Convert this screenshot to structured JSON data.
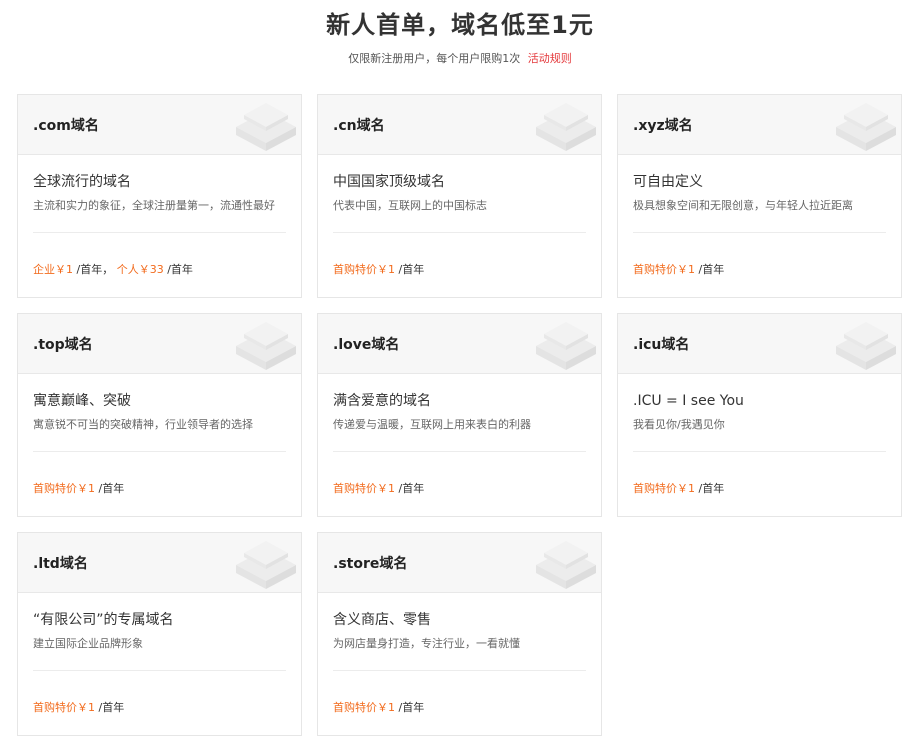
{
  "header": {
    "title": "新人首单，域名低至1元",
    "subtitle": "仅限新注册用户，每个用户限购1次",
    "rules_link": "活动规则"
  },
  "colors": {
    "accent_orange": "#f26b1d",
    "link_red": "#e4393c"
  },
  "cards": [
    {
      "name": ".com域名",
      "tagline": "全球流行的域名",
      "desc": "主流和实力的象征，全球注册量第一，流通性最好",
      "price_a": "企业￥1",
      "unit_a": "/首年，",
      "price_b": "个人￥33",
      "unit_b": "/首年"
    },
    {
      "name": ".cn域名",
      "tagline": "中国国家顶级域名",
      "desc": "代表中国，互联网上的中国标志",
      "price_a": "首购特价￥1",
      "unit_a": "/首年",
      "price_b": "",
      "unit_b": ""
    },
    {
      "name": ".xyz域名",
      "tagline": "可自由定义",
      "desc": "极具想象空间和无限创意，与年轻人拉近距离",
      "price_a": "首购特价￥1",
      "unit_a": "/首年",
      "price_b": "",
      "unit_b": ""
    },
    {
      "name": ".top域名",
      "tagline": "寓意巅峰、突破",
      "desc": "寓意锐不可当的突破精神，行业领导者的选择",
      "price_a": "首购特价￥1",
      "unit_a": "/首年",
      "price_b": "",
      "unit_b": ""
    },
    {
      "name": ".love域名",
      "tagline": "满含爱意的域名",
      "desc": "传递爱与温暖，互联网上用来表白的利器",
      "price_a": "首购特价￥1",
      "unit_a": "/首年",
      "price_b": "",
      "unit_b": ""
    },
    {
      "name": ".icu域名",
      "tagline": ".ICU = I see You",
      "desc": "我看见你/我遇见你",
      "price_a": "首购特价￥1",
      "unit_a": "/首年",
      "price_b": "",
      "unit_b": ""
    },
    {
      "name": ".ltd域名",
      "tagline": "“有限公司”的专属域名",
      "desc": "建立国际企业品牌形象",
      "price_a": "首购特价￥1",
      "unit_a": "/首年",
      "price_b": "",
      "unit_b": ""
    },
    {
      "name": ".store域名",
      "tagline": "含义商店、零售",
      "desc": "为网店量身打造，专注行业，一看就懂",
      "price_a": "首购特价￥1",
      "unit_a": "/首年",
      "price_b": "",
      "unit_b": ""
    }
  ]
}
